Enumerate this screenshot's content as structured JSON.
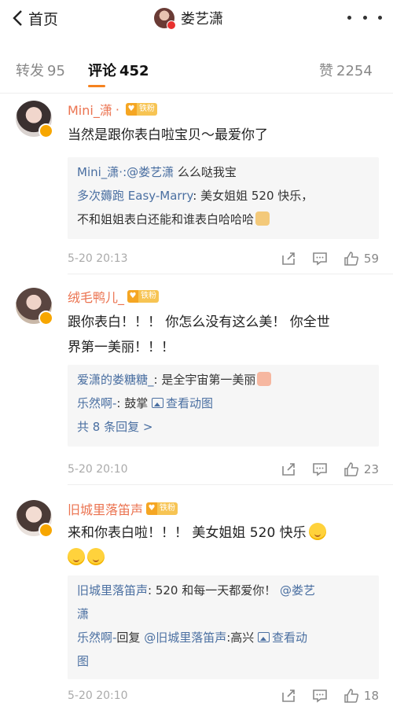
{
  "nav": {
    "back_label": "首页",
    "title": "娄艺潇"
  },
  "tabs": [
    {
      "label": "转发",
      "count": "95"
    },
    {
      "label": "评论",
      "count": "452"
    },
    {
      "label": "赞",
      "count": "2254"
    }
  ],
  "comments": [
    {
      "user": "Mini_潇",
      "badge": "铁粉",
      "text": "当然是跟你表白啦宝贝～最爱你了",
      "reply1_user": "Mini_潇",
      "reply1_sep": "·:",
      "reply1_mention": "@娄艺潇",
      "reply1_text": " 么么哒我宝",
      "reply2_user": "多次薅跑 Easy-Marry",
      "reply2_text_a": ": 美女姐姐 520 快乐，",
      "reply2_text_b": "不和姐姐表白还能和谁表白哈哈哈",
      "time": "5-20 20:13",
      "likes": "59"
    },
    {
      "user": "绒毛鸭儿_",
      "badge": "铁粉",
      "text_a": "跟你表白！！！ 你怎么没有这么美！ 你全世",
      "text_b": "界第一美丽！！！",
      "reply1_user": "爱潇的娄糖糖_",
      "reply1_text": ": 是全宇宙第一美丽",
      "reply2_user": "乐然啊-",
      "reply2_text": ": 鼓掌 ",
      "reply2_link": "查看动图",
      "more": "共 8 条回复 >",
      "time": "5-20 20:10",
      "likes": "23"
    },
    {
      "user": "旧城里落笛声",
      "badge": "铁粉",
      "text_a": "来和你表白啦！！！ 美女姐姐 520 快乐",
      "reply1_user": "旧城里落笛声",
      "reply1_text": ": 520 和每一天都爱你！",
      "reply1_mention_a": "@娄艺",
      "reply1_mention_b": "潇",
      "reply2_user": "乐然啊-",
      "reply2_text_a": "回复 ",
      "reply2_mention": "@旧城里落笛声",
      "reply2_text_b": ":高兴 ",
      "reply2_link_a": "查看动",
      "reply2_link_b": "图",
      "time": "5-20 20:10",
      "likes": "18"
    }
  ]
}
